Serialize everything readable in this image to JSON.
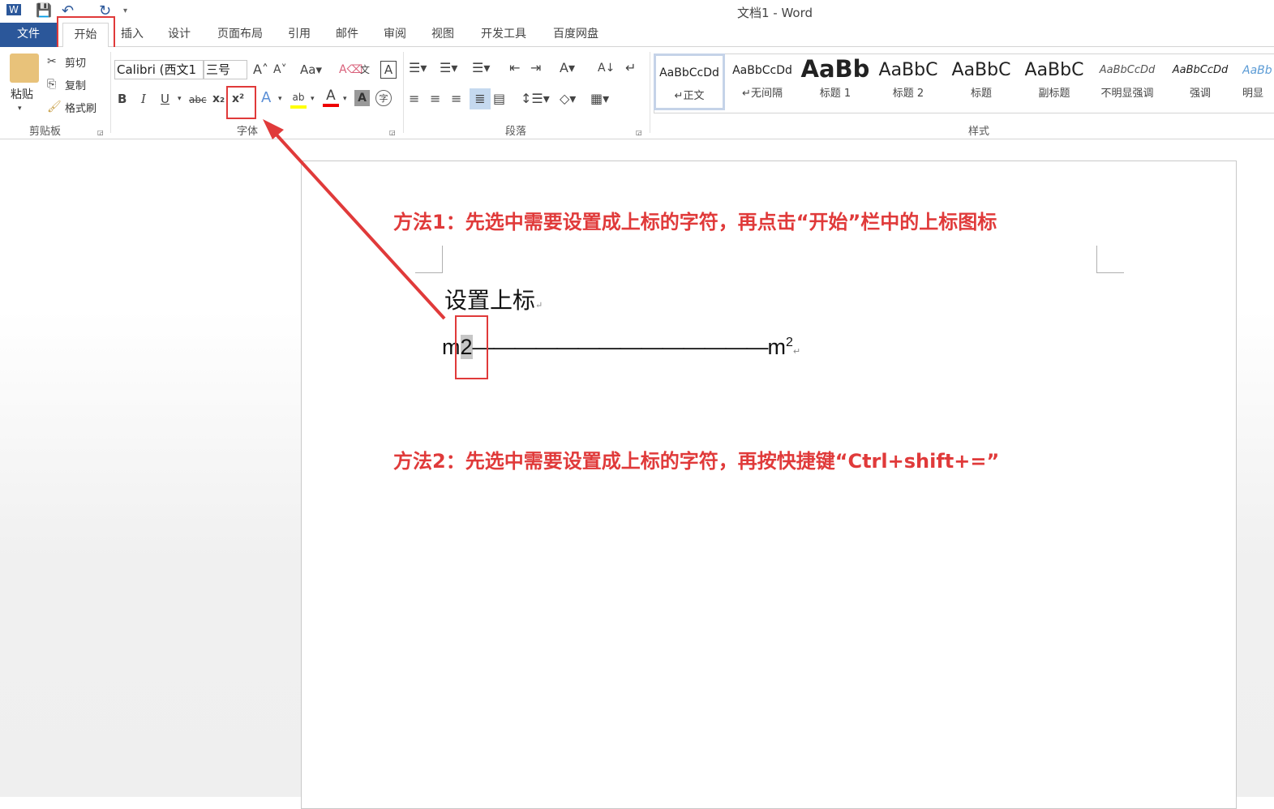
{
  "titlebar": {
    "title": "文档1 - Word",
    "icons": [
      "word-logo-icon",
      "save-icon",
      "undo-icon",
      "redo-icon",
      "customize-icon"
    ]
  },
  "tabs": [
    "文件",
    "开始",
    "插入",
    "设计",
    "页面布局",
    "引用",
    "邮件",
    "审阅",
    "视图",
    "开发工具",
    "百度网盘"
  ],
  "clipboard": {
    "paste": "粘贴",
    "cut": "剪切",
    "copy": "复制",
    "format_painter": "格式刷",
    "label": "剪贴板"
  },
  "font": {
    "name": "Calibri (西文1",
    "size": "三号",
    "label": "字体",
    "bold": "B",
    "italic": "I",
    "underline": "U",
    "strike": "abc",
    "subscript": "x₂",
    "superscript": "x²"
  },
  "paragraph": {
    "label": "段落"
  },
  "styles": {
    "label": "样式",
    "items": [
      {
        "sample": "AaBbCcDd",
        "name": "↵正文"
      },
      {
        "sample": "AaBbCcDd",
        "name": "↵无间隔"
      },
      {
        "sample": "AaBb",
        "name": "标题 1"
      },
      {
        "sample": "AaBbC",
        "name": "标题 2"
      },
      {
        "sample": "AaBbC",
        "name": "标题"
      },
      {
        "sample": "AaBbC",
        "name": "副标题"
      },
      {
        "sample": "AaBbCcDd",
        "name": "不明显强调"
      },
      {
        "sample": "AaBbCcDd",
        "name": "强调"
      },
      {
        "sample": "AaBb",
        "name": "明显"
      }
    ]
  },
  "document": {
    "note1": "方法1：先选中需要设置成上标的字符，再点击“开始”栏中的上标图标",
    "heading": "设置上标",
    "line_start": "m",
    "selected": "2",
    "dashes": "——————————————",
    "line_end": "m",
    "superscript": "2",
    "mark": "↵",
    "note2": "方法2：先选中需要设置成上标的字符，再按快捷键“Ctrl+shift+=”"
  },
  "colors": {
    "accent": "#2b579a",
    "annotation": "#e03a3a"
  }
}
